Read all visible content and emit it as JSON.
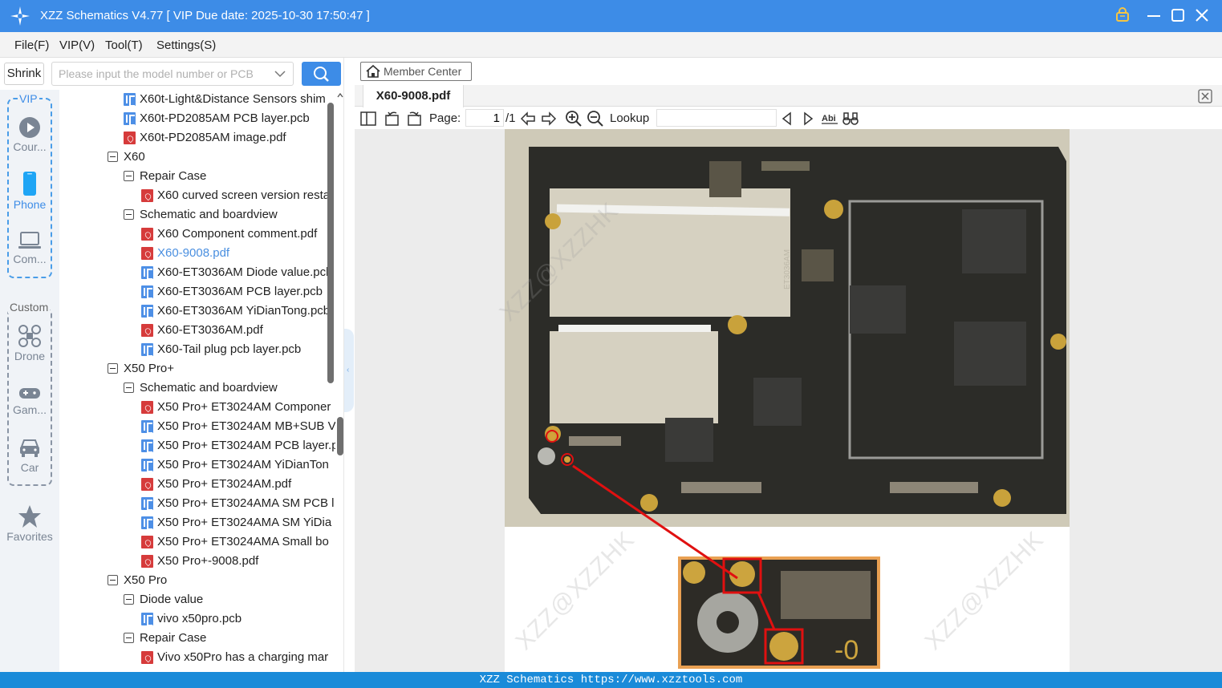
{
  "window": {
    "title": "XZZ Schematics V4.77 [ VIP Due date: 2025-10-30 17:50:47 ]"
  },
  "menu": [
    "File(F)",
    "VIP(V)",
    "Tool(T)",
    "Settings(S)"
  ],
  "search": {
    "shrink_label": "Shrink",
    "placeholder": "Please input the model number or PCB"
  },
  "rail": {
    "vip_title": "VIP",
    "custom_title": "Custom",
    "items": [
      {
        "label": "Cour...",
        "icon": "play-icon"
      },
      {
        "label": "Phone",
        "icon": "phone-icon"
      },
      {
        "label": "Com...",
        "icon": "laptop-icon"
      },
      {
        "label": "Drone",
        "icon": "drone-icon"
      },
      {
        "label": "Gam...",
        "icon": "gamepad-icon"
      },
      {
        "label": "Car",
        "icon": "car-icon"
      },
      {
        "label": "Favorites",
        "icon": "star-icon"
      }
    ]
  },
  "tree": [
    {
      "label": "X60t-Light&Distance Sensors shim",
      "type": "pcb",
      "level": 1
    },
    {
      "label": "X60t-PD2085AM PCB layer.pcb",
      "type": "pcb",
      "level": 1
    },
    {
      "label": "X60t-PD2085AM image.pdf",
      "type": "pdf",
      "level": 1
    },
    {
      "label": "X60",
      "type": "folder",
      "level": 0
    },
    {
      "label": "Repair Case",
      "type": "folder",
      "level": 1
    },
    {
      "label": "X60 curved screen version restar",
      "type": "pdf",
      "level": 2
    },
    {
      "label": "Schematic and boardview",
      "type": "folder",
      "level": 1
    },
    {
      "label": "X60 Component comment.pdf",
      "type": "pdf",
      "level": 2
    },
    {
      "label": "X60-9008.pdf",
      "type": "pdf",
      "level": 2,
      "selected": true
    },
    {
      "label": "X60-ET3036AM Diode value.pcb",
      "type": "pcb",
      "level": 2
    },
    {
      "label": "X60-ET3036AM PCB layer.pcb",
      "type": "pcb",
      "level": 2
    },
    {
      "label": "X60-ET3036AM YiDianTong.pcb",
      "type": "pcb",
      "level": 2
    },
    {
      "label": "X60-ET3036AM.pdf",
      "type": "pdf",
      "level": 2
    },
    {
      "label": "X60-Tail plug pcb layer.pcb",
      "type": "pcb",
      "level": 2
    },
    {
      "label": "X50 Pro+",
      "type": "folder",
      "level": 0
    },
    {
      "label": "Schematic and boardview",
      "type": "folder",
      "level": 1
    },
    {
      "label": "X50 Pro+ ET3024AM Componer",
      "type": "pdf",
      "level": 2
    },
    {
      "label": "X50 Pro+ ET3024AM MB+SUB V",
      "type": "pcb",
      "level": 2
    },
    {
      "label": "X50 Pro+ ET3024AM PCB layer.p",
      "type": "pcb",
      "level": 2
    },
    {
      "label": "X50 Pro+ ET3024AM YiDianTon",
      "type": "pcb",
      "level": 2
    },
    {
      "label": "X50 Pro+ ET3024AM.pdf",
      "type": "pdf",
      "level": 2
    },
    {
      "label": "X50 Pro+ ET3024AMA SM PCB l",
      "type": "pcb",
      "level": 2
    },
    {
      "label": "X50 Pro+ ET3024AMA SM YiDia",
      "type": "pcb",
      "level": 2
    },
    {
      "label": "X50 Pro+ ET3024AMA Small bo",
      "type": "pdf",
      "level": 2
    },
    {
      "label": "X50 Pro+-9008.pdf",
      "type": "pdf",
      "level": 2
    },
    {
      "label": "X50 Pro",
      "type": "folder",
      "level": 0
    },
    {
      "label": "Diode value",
      "type": "folder",
      "level": 1
    },
    {
      "label": "vivo x50pro.pcb",
      "type": "pcb",
      "level": 2
    },
    {
      "label": "Repair Case",
      "type": "folder",
      "level": 1
    },
    {
      "label": "Vivo x50Pro has a charging mar",
      "type": "pdf",
      "level": 2
    }
  ],
  "viewer": {
    "member_center": "Member Center",
    "tab": "X60-9008.pdf",
    "page_label": "Page:",
    "page_current": "1",
    "page_total": "/1",
    "lookup_label": "Lookup",
    "watermark": "XZZ@XZZHK",
    "silk_text": "ET3036AM",
    "zoom_text": "-0"
  },
  "statusbar": "XZZ Schematics https://www.xzztools.com",
  "colors": {
    "accent": "#3d8ce7",
    "pdf_icon": "#d63b3b",
    "pcb_icon": "#4d8fe6",
    "callout": "#e01010"
  }
}
